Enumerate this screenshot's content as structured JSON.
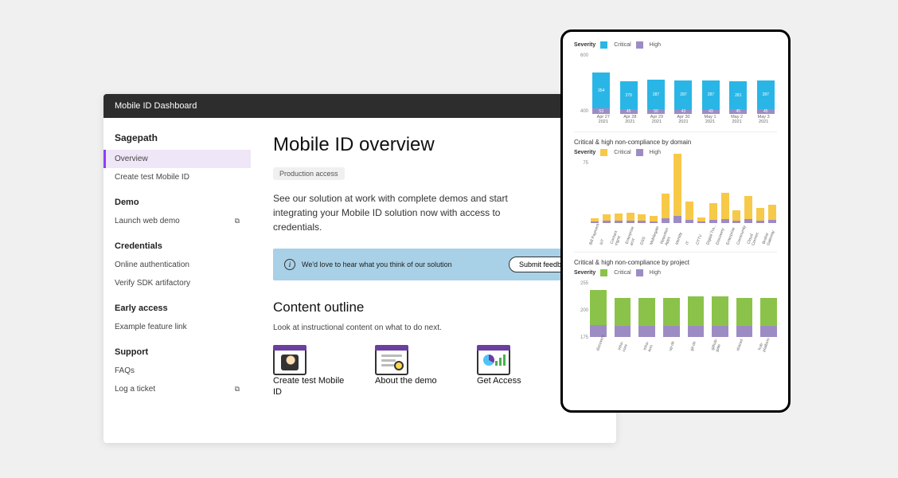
{
  "header": {
    "title": "Mobile ID Dashboard"
  },
  "sidebar": {
    "brand": "Sagepath",
    "items": [
      {
        "label": "Overview",
        "active": true
      },
      {
        "label": "Create test Mobile ID"
      }
    ],
    "groups": [
      {
        "title": "Demo",
        "items": [
          {
            "label": "Launch web demo",
            "external": true
          }
        ]
      },
      {
        "title": "Credentials",
        "items": [
          {
            "label": "Online authentication"
          },
          {
            "label": "Verify SDK artifactory"
          }
        ]
      },
      {
        "title": "Early access",
        "items": [
          {
            "label": "Example feature link"
          }
        ]
      },
      {
        "title": "Support",
        "items": [
          {
            "label": "FAQs"
          },
          {
            "label": "Log a ticket",
            "external": true
          }
        ]
      }
    ]
  },
  "main": {
    "title": "Mobile ID overview",
    "badge": "Production access",
    "intro": "See our solution at work with complete demos and start integrating your Mobile ID solution now with access to credentials.",
    "banner": {
      "text": "We'd love to hear what you think of our solution",
      "button": "Submit feedback"
    },
    "outline_title": "Content outline",
    "outline_sub": "Look at instructional content on what to do next.",
    "cards": [
      {
        "title": "Create test Mobile ID"
      },
      {
        "title": "About the demo"
      },
      {
        "title": "Get Access"
      }
    ]
  },
  "tablet": {
    "chart1_legend_label": "Severity",
    "legend_critical": "Critical",
    "legend_high": "High",
    "chart2_title": "Critical & high non-compliance by domain",
    "chart3_title": "Critical & high non-compliance by project"
  },
  "colors": {
    "critical_cyan": "#29b6e6",
    "high_purple": "#9d8cc4",
    "critical_yellow": "#f7c948",
    "critical_green": "#8bc34a"
  },
  "chart_data": [
    {
      "type": "bar",
      "title": "Severity",
      "categories": [
        "Apr 27 2021",
        "Apr 28 2021",
        "Apr 29 2021",
        "Apr 30 2021",
        "May 1 2021",
        "May 2 2021",
        "May 3 2021"
      ],
      "series": [
        {
          "name": "Critical",
          "values": [
            354,
            279,
            287,
            287,
            287,
            281,
            287
          ],
          "color": "#29b6e6"
        },
        {
          "name": "High",
          "values": [
            53,
            45,
            50,
            43,
            43,
            45,
            45
          ],
          "color": "#9d8cc4"
        }
      ],
      "ylim": [
        0,
        600
      ],
      "yticks": [
        600,
        400
      ]
    },
    {
      "type": "bar",
      "title": "Critical & high non-compliance by domain",
      "categories": [
        "Bill Payment",
        "IoT",
        "Contact mgmt",
        "Enterprise acct",
        "DSS",
        "Mobilegate",
        "Retention Apps",
        "Identity",
        "IT",
        "OTTV",
        "Digital Tra...",
        "Discovery",
        "Enterprise",
        "Community",
        "Cloud Connec",
        "Broker Gateway"
      ],
      "series": [
        {
          "name": "Critical",
          "values": [
            4,
            8,
            9,
            10,
            8,
            7,
            30,
            75,
            22,
            5,
            20,
            32,
            12,
            28,
            15,
            18
          ],
          "color": "#f7c948"
        },
        {
          "name": "High",
          "values": [
            2,
            3,
            3,
            3,
            3,
            2,
            6,
            9,
            4,
            2,
            4,
            5,
            3,
            5,
            3,
            4
          ],
          "color": "#9d8cc4"
        }
      ],
      "ylim": [
        0,
        75
      ],
      "yticks": [
        75
      ]
    },
    {
      "type": "bar",
      "title": "Critical & high non-compliance by project",
      "categories": [
        "discovery",
        "infra-core",
        "infra-aws",
        "up-dir",
        "git-dir",
        "github-gate",
        "shared",
        "hub-platform"
      ],
      "series": [
        {
          "name": "Critical",
          "values": [
            160,
            130,
            130,
            130,
            135,
            135,
            130,
            130
          ],
          "color": "#8bc34a"
        },
        {
          "name": "High",
          "values": [
            55,
            50,
            50,
            50,
            50,
            50,
            50,
            50
          ],
          "color": "#9d8cc4"
        }
      ],
      "ylim": [
        0,
        255
      ],
      "yticks": [
        255,
        200,
        175
      ]
    }
  ]
}
